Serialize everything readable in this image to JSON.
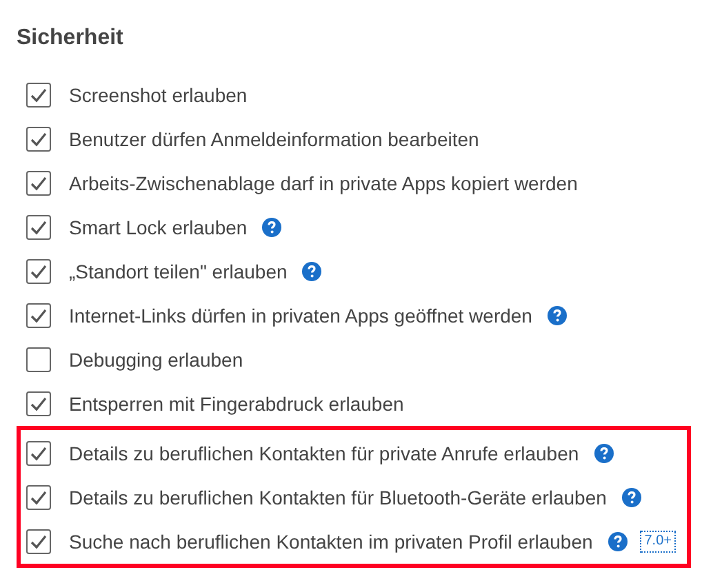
{
  "heading": "Sicherheit",
  "items": [
    {
      "label": "Screenshot erlauben",
      "checked": true,
      "help": false
    },
    {
      "label": "Benutzer dürfen Anmeldeinformation bearbeiten",
      "checked": true,
      "help": false
    },
    {
      "label": "Arbeits-Zwischenablage darf in private Apps kopiert werden",
      "checked": true,
      "help": false
    },
    {
      "label": "Smart Lock erlauben",
      "checked": true,
      "help": true
    },
    {
      "label": "„Standort teilen\" erlauben",
      "checked": true,
      "help": true
    },
    {
      "label": "Internet-Links dürfen in privaten Apps geöffnet werden",
      "checked": true,
      "help": true
    },
    {
      "label": "Debugging erlauben",
      "checked": false,
      "help": false
    },
    {
      "label": "Entsperren mit Fingerabdruck erlauben",
      "checked": true,
      "help": false
    }
  ],
  "highlighted_items": [
    {
      "label": "Details zu beruflichen Kontakten für private Anrufe erlauben",
      "checked": true,
      "help": true
    },
    {
      "label": "Details zu beruflichen Kontakten für Bluetooth-Geräte erlauben",
      "checked": true,
      "help": true
    },
    {
      "label": "Suche nach beruflichen Kontakten im privaten Profil erlauben",
      "checked": true,
      "help": true,
      "badge": "7.0+"
    }
  ]
}
